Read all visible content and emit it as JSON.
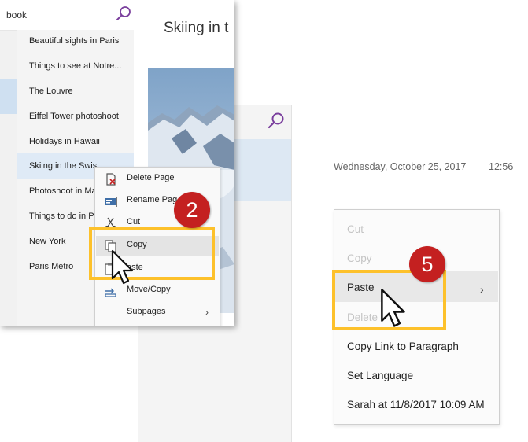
{
  "front_window": {
    "notebook_label": "book",
    "page_title": "Skiing in t",
    "pages": [
      "Beautiful sights in Paris",
      "Things to see at Notre...",
      "The Louvre",
      "Eiffel Tower photoshoot",
      "Holidays in Hawaii",
      "Skiing in the Swiss Alps",
      "Photoshoot in Ma",
      "Things to do in P",
      "New York",
      "Paris Metro"
    ],
    "pages_visible": [
      "Beautiful sights in Paris",
      "Things to see at Notre...",
      "The Louvre",
      "Eiffel Tower photoshoot",
      "Holidays in Hawaii",
      "Skiing in the Swis",
      "Photoshoot in Ma",
      "Things to do in P",
      "New York",
      "Paris Metro"
    ],
    "selected_page_index": 5,
    "context_menu": {
      "items": [
        "Delete Page",
        "Rename Page",
        "Cut",
        "Copy",
        "Paste",
        "Move/Copy",
        "Subpages"
      ],
      "visible_labels": [
        "Delete Page",
        "Rename Pag",
        "Cut",
        "Copy",
        "aste",
        "Move/Copy",
        "Subpages"
      ],
      "icons": [
        "delete-page-icon",
        "rename-page-icon",
        "cut-icon",
        "copy-icon",
        "paste-icon",
        "move-copy-icon",
        ""
      ],
      "highlighted": "Copy",
      "submenu_arrow": "›"
    }
  },
  "back_window": {
    "date": "Wednesday, October 25, 2017",
    "time": "12:56",
    "context_menu": {
      "items": [
        {
          "label": "Cut",
          "enabled": false
        },
        {
          "label": "Copy",
          "enabled": false
        },
        {
          "label": "Paste",
          "enabled": true
        },
        {
          "label": "Delete",
          "enabled": false
        },
        {
          "label": "Copy Link to Paragraph",
          "enabled": true
        },
        {
          "label": "Set Language",
          "enabled": true
        },
        {
          "label": "Sarah at 11/8/2017 10:09 AM",
          "enabled": true
        }
      ],
      "highlighted": "Paste",
      "submenu_arrow": "›"
    }
  },
  "annotations": {
    "step_a": "2",
    "step_b": "5",
    "highlight_color": "#fdc12b",
    "badge_color": "#c42020"
  }
}
